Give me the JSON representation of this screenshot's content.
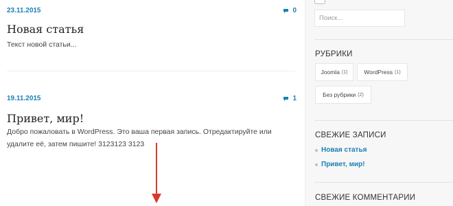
{
  "posts": [
    {
      "date": "23.11.2015",
      "comments": "0",
      "title": "Новая статья",
      "excerpt": "Текст новой статьи..."
    },
    {
      "date": "19.11.2015",
      "comments": "1",
      "title": "Привет, мир!",
      "excerpt_line1": "Добро пожаловать в WordPress. Это ваша первая запись. Отредактируйте или",
      "excerpt_line2": "удалите её, затем пишите! 3123123 3123"
    }
  ],
  "sidebar": {
    "search_placeholder": "Поиск...",
    "categories_heading": "РУБРИКИ",
    "categories": [
      {
        "label": "Joomla",
        "count": "(1)"
      },
      {
        "label": "WordPress",
        "count": "(1)"
      },
      {
        "label": "Без рубрики",
        "count": "(2)"
      }
    ],
    "recent_posts_heading": "СВЕЖИЕ ЗАПИСИ",
    "recent_posts": [
      "Новая статья",
      "Привет, мир!"
    ],
    "recent_comments_heading": "СВЕЖИЕ КОММЕНТАРИИ"
  },
  "colors": {
    "accent": "#1a7fb5",
    "annotation_arrow": "#d63a2f",
    "sidebar_bg": "#f7f7f7"
  },
  "icons": {
    "comment": "comment-bubble-icon"
  }
}
